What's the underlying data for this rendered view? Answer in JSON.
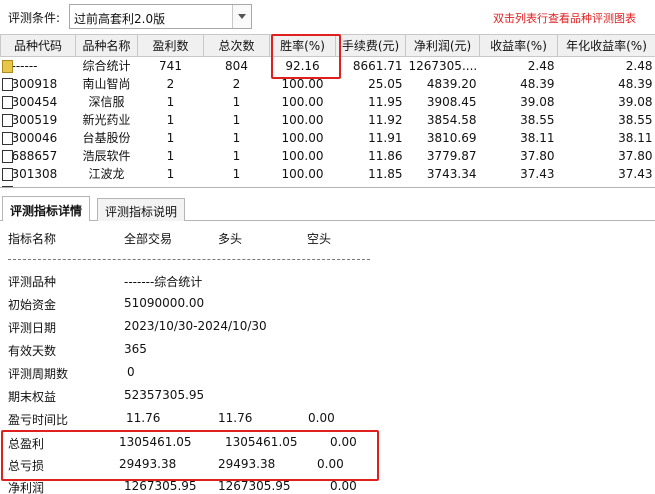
{
  "toolbar": {
    "condition_label": "评测条件:",
    "condition_value": "过前高套利2.0版",
    "hint": "双击列表行查看品种评测图表"
  },
  "table": {
    "columns": [
      "品种代码",
      "品种名称",
      "盈利数",
      "总次数",
      "胜率(%)",
      "手续费(元)",
      "净利润(元)",
      "收益率(%)",
      "年化收益率(%)"
    ],
    "rows": [
      [
        "------",
        "综合统计",
        "741",
        "804",
        "92.16",
        "8661.71",
        "1267305....",
        "2.48",
        "2.48"
      ],
      [
        "300918",
        "南山智尚",
        "2",
        "2",
        "100.00",
        "25.05",
        "4839.20",
        "48.39",
        "48.39"
      ],
      [
        "300454",
        "深信服",
        "1",
        "1",
        "100.00",
        "11.95",
        "3908.45",
        "39.08",
        "39.08"
      ],
      [
        "300519",
        "新光药业",
        "1",
        "1",
        "100.00",
        "11.92",
        "3854.58",
        "38.55",
        "38.55"
      ],
      [
        "300046",
        "台基股份",
        "1",
        "1",
        "100.00",
        "11.91",
        "3810.69",
        "38.11",
        "38.11"
      ],
      [
        "688657",
        "浩辰软件",
        "1",
        "1",
        "100.00",
        "11.86",
        "3779.87",
        "37.80",
        "37.80"
      ],
      [
        "301308",
        "江波龙",
        "1",
        "1",
        "100.00",
        "11.85",
        "3743.34",
        "37.43",
        "37.43"
      ],
      [
        "",
        "",
        "",
        "",
        "",
        "",
        "",
        "",
        ""
      ]
    ]
  },
  "tabs": [
    "评测指标详情",
    "评测指标说明"
  ],
  "detail": {
    "headers": [
      "指标名称",
      "全部交易",
      "多头",
      "空头"
    ],
    "items": [
      {
        "label": "评测品种",
        "values": [
          "-------综合统计",
          "",
          ""
        ]
      },
      {
        "label": "初始资金",
        "values": [
          "51090000.00",
          "",
          ""
        ]
      },
      {
        "label": "评测日期",
        "values": [
          "2023/10/30-2024/10/30",
          "",
          ""
        ]
      },
      {
        "label": "有效天数",
        "values": [
          "365",
          "",
          ""
        ]
      },
      {
        "label": "评测周期数",
        "values": [
          "0",
          "",
          ""
        ]
      },
      {
        "label": "期末权益",
        "values": [
          "52357305.95",
          "",
          ""
        ]
      },
      {
        "label": "盈亏时间比",
        "values": [
          "11.76",
          "11.76",
          "0.00"
        ]
      },
      {
        "label": "总盈利",
        "values": [
          "1305461.05",
          "1305461.05",
          "0.00"
        ]
      },
      {
        "label": "总亏损",
        "values": [
          "29493.38",
          "29493.38",
          "0.00"
        ]
      },
      {
        "label": "净利润",
        "values": [
          "1267305.95",
          "1267305.95",
          "0.00"
        ]
      }
    ]
  },
  "colors": {
    "highlight": "#e0201e",
    "hint": "#e02020"
  },
  "icons": {
    "folder_row": "folder-icon",
    "doc_row": "document-icon",
    "combo": "chevron-down-icon"
  }
}
